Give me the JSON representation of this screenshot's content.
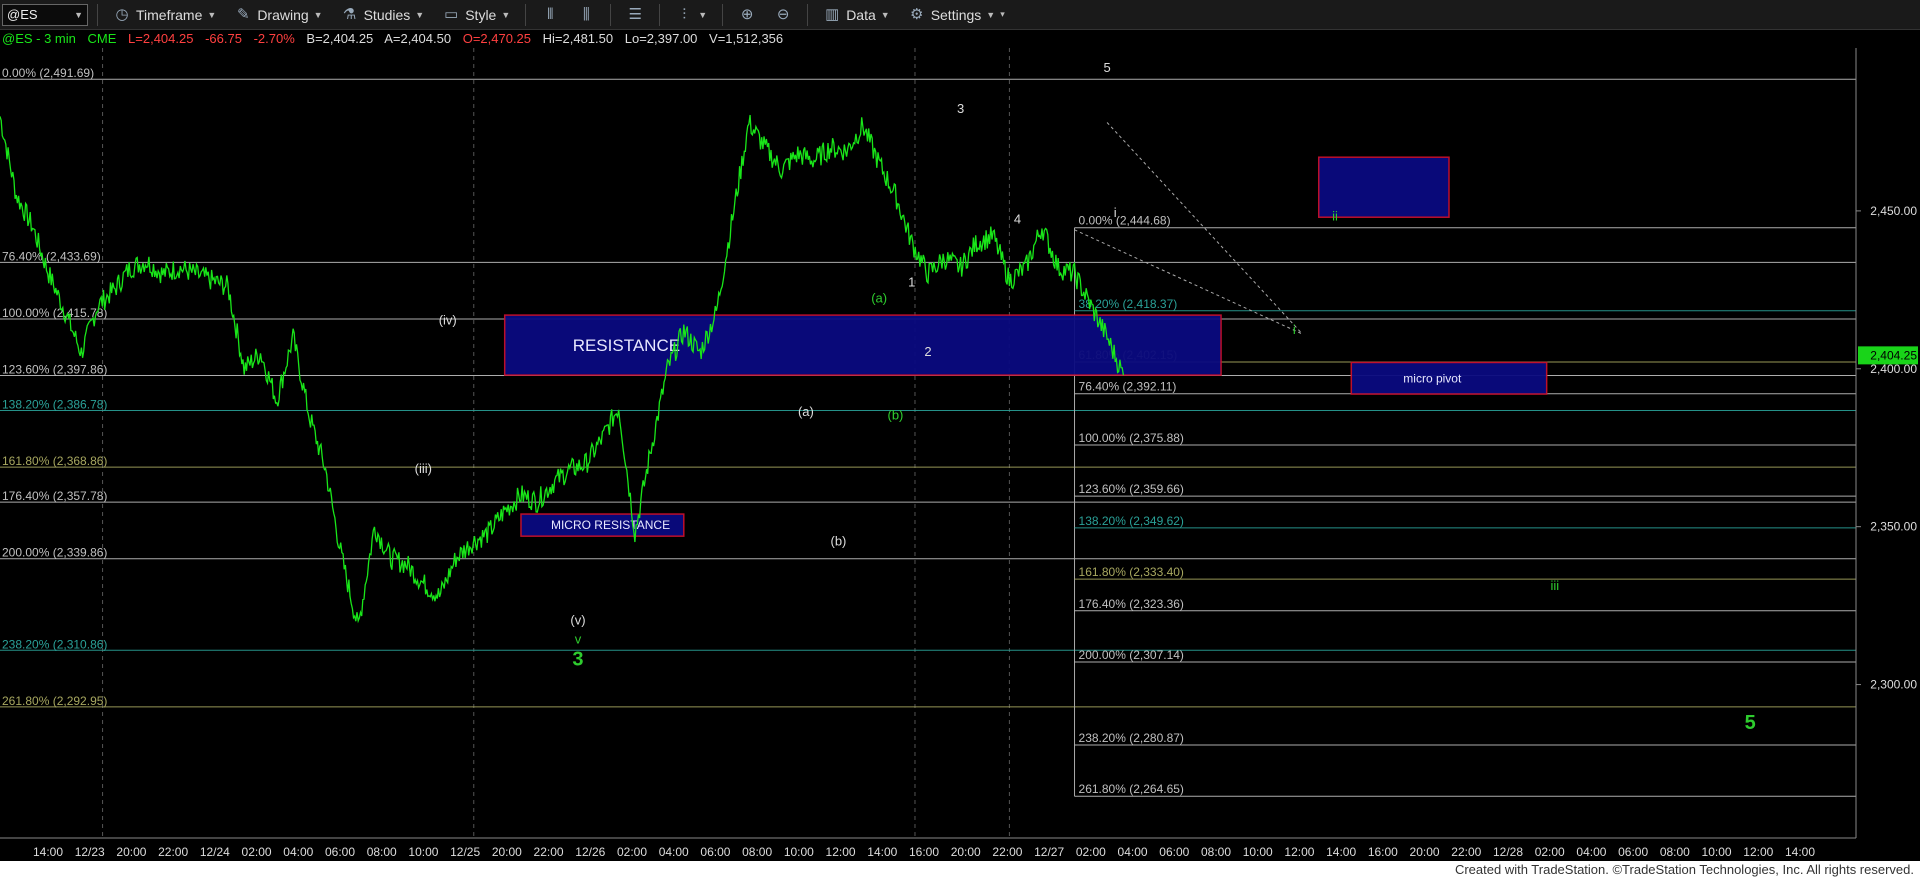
{
  "toolbar": {
    "symbol": "@ES",
    "items": [
      {
        "label": "Timeframe",
        "icon": "clock-icon"
      },
      {
        "label": "Drawing",
        "icon": "pencil-icon"
      },
      {
        "label": "Studies",
        "icon": "flask-icon"
      },
      {
        "label": "Style",
        "icon": "style-icon"
      },
      {
        "label": "Data",
        "icon": "bar-chart-icon"
      },
      {
        "label": "Settings",
        "icon": "gear-icon"
      }
    ]
  },
  "quote": {
    "symbol": "@ES - 3 min",
    "exchange": "CME",
    "last": "L=2,404.25",
    "change": "-66.75",
    "pct": "-2.70%",
    "bid": "B=2,404.25",
    "ask": "A=2,404.50",
    "open": "O=2,470.25",
    "high": "Hi=2,481.50",
    "low": "Lo=2,397.00",
    "volume": "V=1,512,356"
  },
  "footer": "Created with TradeStation. ©TradeStation Technologies, Inc. All rights reserved.",
  "colors": {
    "price": "#19e619",
    "zone": "#0a0a80",
    "zone_border": "#c8102e",
    "axis": "#ddd",
    "last_badge": "#19d419",
    "green_label": "#2ecc2e"
  },
  "chart_data": {
    "type": "line",
    "title": "@ES - 3 min",
    "y_axis": {
      "ticks": [
        2450,
        2400,
        2350,
        2300
      ],
      "tick_labels": [
        "2,450.00",
        "2,400.00",
        "2,350.00",
        "2,300.00"
      ],
      "ylim": [
        2253,
        2500
      ]
    },
    "last_price_label": "2,404.25",
    "x_tick_labels": [
      "14:00",
      "12/23",
      "20:00",
      "22:00",
      "12/24",
      "02:00",
      "04:00",
      "06:00",
      "08:00",
      "10:00",
      "12/25",
      "20:00",
      "22:00",
      "12/26",
      "02:00",
      "04:00",
      "06:00",
      "08:00",
      "10:00",
      "12:00",
      "14:00",
      "16:00",
      "20:00",
      "22:00",
      "12/27",
      "02:00",
      "04:00",
      "06:00",
      "08:00",
      "10:00",
      "12:00",
      "14:00",
      "16:00",
      "20:00",
      "22:00",
      "12/28",
      "02:00",
      "04:00",
      "06:00",
      "08:00",
      "10:00",
      "12:00",
      "14:00"
    ],
    "price_waypoints": [
      [
        0,
        2480
      ],
      [
        1,
        2455
      ],
      [
        2,
        2445
      ],
      [
        3,
        2430
      ],
      [
        4,
        2418
      ],
      [
        5,
        2405
      ],
      [
        6,
        2420
      ],
      [
        7,
        2425
      ],
      [
        8,
        2432
      ],
      [
        9,
        2434
      ],
      [
        10,
        2430
      ],
      [
        11,
        2432
      ],
      [
        12,
        2430
      ],
      [
        13,
        2428
      ],
      [
        14,
        2426
      ],
      [
        15,
        2400
      ],
      [
        16,
        2405
      ],
      [
        17,
        2390
      ],
      [
        18,
        2410
      ],
      [
        19,
        2385
      ],
      [
        20,
        2368
      ],
      [
        21,
        2340
      ],
      [
        22,
        2318
      ],
      [
        23,
        2350
      ],
      [
        24,
        2340
      ],
      [
        25,
        2338
      ],
      [
        26,
        2332
      ],
      [
        27,
        2328
      ],
      [
        28,
        2340
      ],
      [
        29,
        2345
      ],
      [
        30,
        2348
      ],
      [
        31,
        2355
      ],
      [
        32,
        2360
      ],
      [
        33,
        2358
      ],
      [
        34,
        2364
      ],
      [
        35,
        2368
      ],
      [
        36,
        2370
      ],
      [
        37,
        2378
      ],
      [
        38,
        2388
      ],
      [
        39,
        2348
      ],
      [
        40,
        2375
      ],
      [
        41,
        2400
      ],
      [
        42,
        2412
      ],
      [
        43,
        2405
      ],
      [
        44,
        2418
      ],
      [
        45,
        2448
      ],
      [
        46,
        2478
      ],
      [
        47,
        2470
      ],
      [
        48,
        2463
      ],
      [
        49,
        2468
      ],
      [
        50,
        2466
      ],
      [
        51,
        2470
      ],
      [
        52,
        2469
      ],
      [
        53,
        2477
      ],
      [
        54,
        2465
      ],
      [
        55,
        2455
      ],
      [
        56,
        2440
      ],
      [
        57,
        2430
      ],
      [
        58,
        2435
      ],
      [
        59,
        2432
      ],
      [
        60,
        2440
      ],
      [
        61,
        2442
      ],
      [
        62,
        2428
      ],
      [
        63,
        2432
      ],
      [
        64,
        2445
      ],
      [
        65,
        2432
      ],
      [
        66,
        2430
      ],
      [
        67,
        2420
      ],
      [
        68,
        2410
      ],
      [
        69,
        2398
      ]
    ],
    "fib_left": [
      {
        "label": "0.00% (2,491.69)",
        "value": 2491.69,
        "color": "#c0c0c0"
      },
      {
        "label": "76.40% (2,433.69)",
        "value": 2433.69,
        "color": "#c0c0c0"
      },
      {
        "label": "100.00% (2,415.78)",
        "value": 2415.78,
        "color": "#c0c0c0"
      },
      {
        "label": "123.60% (2,397.86)",
        "value": 2397.86,
        "color": "#c0c0c0"
      },
      {
        "label": "138.20% (2,386.78)",
        "value": 2386.78,
        "color": "#2aa198"
      },
      {
        "label": "161.80% (2,368.86)",
        "value": 2368.86,
        "color": "#a8a860"
      },
      {
        "label": "176.40% (2,357.78)",
        "value": 2357.78,
        "color": "#c0c0c0"
      },
      {
        "label": "200.00% (2,339.86)",
        "value": 2339.86,
        "color": "#c0c0c0"
      },
      {
        "label": "238.20% (2,310.86)",
        "value": 2310.86,
        "color": "#2aa198"
      },
      {
        "label": "261.80% (2,292.95)",
        "value": 2292.95,
        "color": "#a8a860"
      }
    ],
    "fib_right": [
      {
        "label": "0.00% (2,444.68)",
        "value": 2444.68,
        "color": "#c0c0c0"
      },
      {
        "label": "38.20% (2,418.37)",
        "value": 2418.37,
        "color": "#2aa198"
      },
      {
        "label": "61.80% (2,402.15)",
        "value": 2402.15,
        "color": "#a8a860"
      },
      {
        "label": "76.40% (2,392.11)",
        "value": 2392.11,
        "color": "#c0c0c0"
      },
      {
        "label": "100.00% (2,375.88)",
        "value": 2375.88,
        "color": "#c0c0c0"
      },
      {
        "label": "123.60% (2,359.66)",
        "value": 2359.66,
        "color": "#c0c0c0"
      },
      {
        "label": "138.20% (2,349.62)",
        "value": 2349.62,
        "color": "#2aa198"
      },
      {
        "label": "161.80% (2,333.40)",
        "value": 2333.4,
        "color": "#a8a860"
      },
      {
        "label": "176.40% (2,323.36)",
        "value": 2323.36,
        "color": "#c0c0c0"
      },
      {
        "label": "200.00% (2,307.14)",
        "value": 2307.14,
        "color": "#c0c0c0"
      },
      {
        "label": "238.20% (2,280.87)",
        "value": 2280.87,
        "color": "#c0c0c0"
      },
      {
        "label": "261.80% (2,264.65)",
        "value": 2264.65,
        "color": "#c0c0c0"
      }
    ],
    "zones": [
      {
        "label": "RESISTANCE",
        "x0": 31,
        "x1": 75,
        "y0": 2417,
        "y1": 2398
      },
      {
        "label": "MICRO RESISTANCE",
        "x0": 32,
        "x1": 42,
        "y0": 2354,
        "y1": 2347
      },
      {
        "label": "",
        "x0": 81,
        "x1": 89,
        "y0": 2467,
        "y1": 2448
      },
      {
        "label": "micro pivot",
        "x0": 83,
        "x1": 95,
        "y0": 2402,
        "y1": 2392
      }
    ],
    "wave_labels": [
      {
        "text": "(iv)",
        "x": 27.5,
        "y": 2414,
        "color": "#dddddd"
      },
      {
        "text": "(iii)",
        "x": 26,
        "y": 2367,
        "color": "#dddddd"
      },
      {
        "text": "(v)",
        "x": 35.5,
        "y": 2319,
        "color": "#dddddd"
      },
      {
        "text": "v",
        "x": 35.5,
        "y": 2313,
        "color": "#2ecc2e"
      },
      {
        "text": "3",
        "x": 35.5,
        "y": 2306,
        "color": "#2ecc2e"
      },
      {
        "text": "(a)",
        "x": 49.5,
        "y": 2385,
        "color": "#dddddd"
      },
      {
        "text": "(b)",
        "x": 51.5,
        "y": 2344,
        "color": "#dddddd"
      },
      {
        "text": "(a)",
        "x": 54,
        "y": 2421,
        "color": "#2ecc2e"
      },
      {
        "text": "(b)",
        "x": 55,
        "y": 2384,
        "color": "#2ecc2e"
      },
      {
        "text": "1",
        "x": 56,
        "y": 2426,
        "color": "#dddddd"
      },
      {
        "text": "2",
        "x": 57,
        "y": 2404,
        "color": "#dddddd"
      },
      {
        "text": "3",
        "x": 59,
        "y": 2481,
        "color": "#dddddd"
      },
      {
        "text": "4",
        "x": 62.5,
        "y": 2446,
        "color": "#dddddd"
      },
      {
        "text": "5",
        "x": 68,
        "y": 2494,
        "color": "#dddddd"
      },
      {
        "text": "i",
        "x": 68.5,
        "y": 2448,
        "color": "#dddddd"
      },
      {
        "text": "ii",
        "x": 82,
        "y": 2447,
        "color": "#2ecc2e"
      },
      {
        "text": "i",
        "x": 79.5,
        "y": 2411,
        "color": "#2ecc2e"
      },
      {
        "text": "iii",
        "x": 95.5,
        "y": 2330,
        "color": "#2ecc2e"
      },
      {
        "text": "5",
        "x": 107.5,
        "y": 2286,
        "color": "#2ecc2e"
      }
    ],
    "grid": false,
    "legend": "none"
  }
}
